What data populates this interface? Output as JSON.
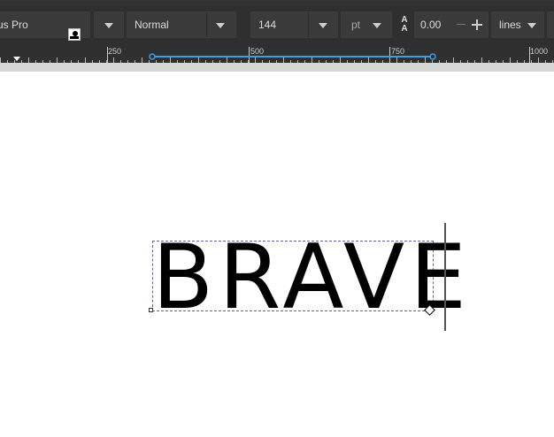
{
  "toolbar": {
    "font_family": "us Pro",
    "font_style": "Normal",
    "font_size": "144",
    "unit": "pt",
    "letter_spacing": "0.00",
    "line_spacing_unit": "lines"
  },
  "ruler": {
    "labels": [
      "250",
      "500",
      "750",
      "1000"
    ]
  },
  "canvas": {
    "text": "BRAVE"
  },
  "colors": {
    "toolbar_bg": "#2f2f2f",
    "ruler_accent": "#3aa0e0",
    "selection_border": "#6b5aa0"
  }
}
